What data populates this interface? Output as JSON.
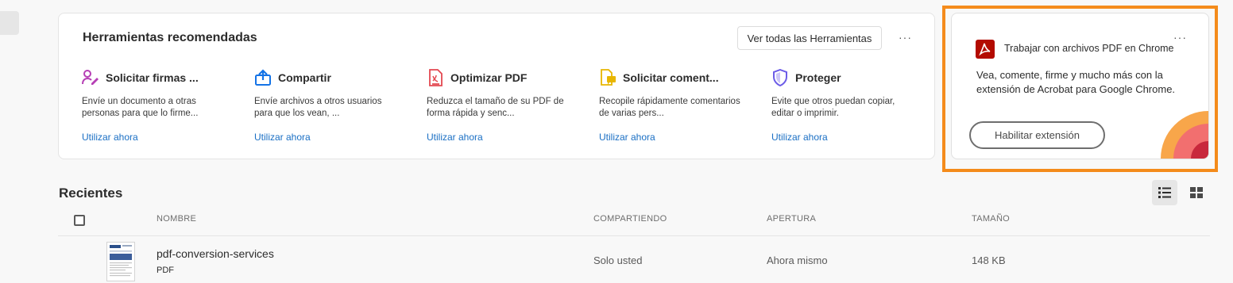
{
  "tools_section": {
    "title": "Herramientas recomendadas",
    "see_all_label": "Ver todas las Herramientas",
    "more_label": "···",
    "tools": [
      {
        "name": "Solicitar firmas ...",
        "desc": "Envíe un documento a otras personas para que lo firme...",
        "link": "Utilizar ahora",
        "icon": "request-signature-icon",
        "color": "#b63fb5"
      },
      {
        "name": "Compartir",
        "desc": "Envíe archivos a otros usuarios para que los vean, ...",
        "link": "Utilizar ahora",
        "icon": "share-upload-icon",
        "color": "#1473e6"
      },
      {
        "name": "Optimizar PDF",
        "desc": "Reduzca el tamaño de su PDF de forma rápida y senc...",
        "link": "Utilizar ahora",
        "icon": "compress-pdf-icon",
        "color": "#e34850"
      },
      {
        "name": "Solicitar coment...",
        "desc": "Recopile rápidamente comentarios de varias pers...",
        "link": "Utilizar ahora",
        "icon": "comment-request-icon",
        "color": "#e8b600"
      },
      {
        "name": "Proteger",
        "desc": "Evite que otros puedan copiar, editar o imprimir.",
        "link": "Utilizar ahora",
        "icon": "shield-icon",
        "color": "#6c5ce7"
      }
    ]
  },
  "promo": {
    "title": "Trabajar con archivos PDF en Chrome",
    "text": "Vea, comente, firme y mucho más con la extensión de Acrobat para Google Chrome.",
    "button_label": "Habilitar extensión",
    "more_label": "···",
    "logo_icon": "acrobat-logo-icon",
    "accent_color": "#f48b1b"
  },
  "recents": {
    "title": "Recientes",
    "columns": {
      "name": "NOMBRE",
      "sharing": "COMPARTIENDO",
      "opened": "APERTURA",
      "size": "TAMAÑO"
    },
    "rows": [
      {
        "name": "pdf-conversion-services",
        "type": "PDF",
        "sharing": "Solo usted",
        "opened": "Ahora mismo",
        "size": "148 KB"
      }
    ]
  }
}
